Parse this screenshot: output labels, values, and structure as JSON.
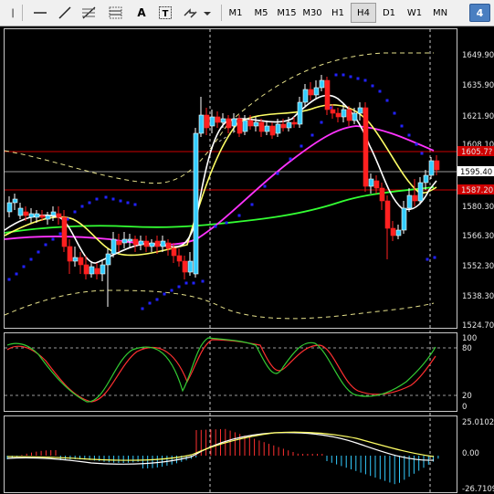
{
  "toolbar": {
    "line_tool": "|",
    "text_tool": "A",
    "textbox_tool": "T",
    "timeframes": [
      "M1",
      "M5",
      "M15",
      "M30",
      "H1",
      "H4",
      "D1",
      "W1",
      "MN"
    ],
    "active_timeframe": "H4",
    "badge": "4"
  },
  "price_axis": {
    "labels": [
      "1649.90",
      "1635.90",
      "1621.90",
      "1608.10",
      "1595.40",
      "1580.30",
      "1566.30",
      "1552.30",
      "1538.30",
      "1524.70"
    ],
    "current_price": "1595.40",
    "level_high": "1605.7?",
    "level_low": "1587.20"
  },
  "stochastic": {
    "labels": [
      "100",
      "80",
      "20",
      "0"
    ]
  },
  "macd": {
    "labels": [
      "25.0102",
      "0.00",
      "-26.7109"
    ]
  },
  "colors": {
    "bull": "#ffffff",
    "bear": "#ff2020",
    "bull_candle_fill": "#33ccff",
    "ma_fast": "#ffffff",
    "ma_mid": "#ffff66",
    "ma_slow": "#ff33ff",
    "ma_long": "#33ff33",
    "psar": "#2222ff",
    "level_line": "#cc0000"
  }
}
